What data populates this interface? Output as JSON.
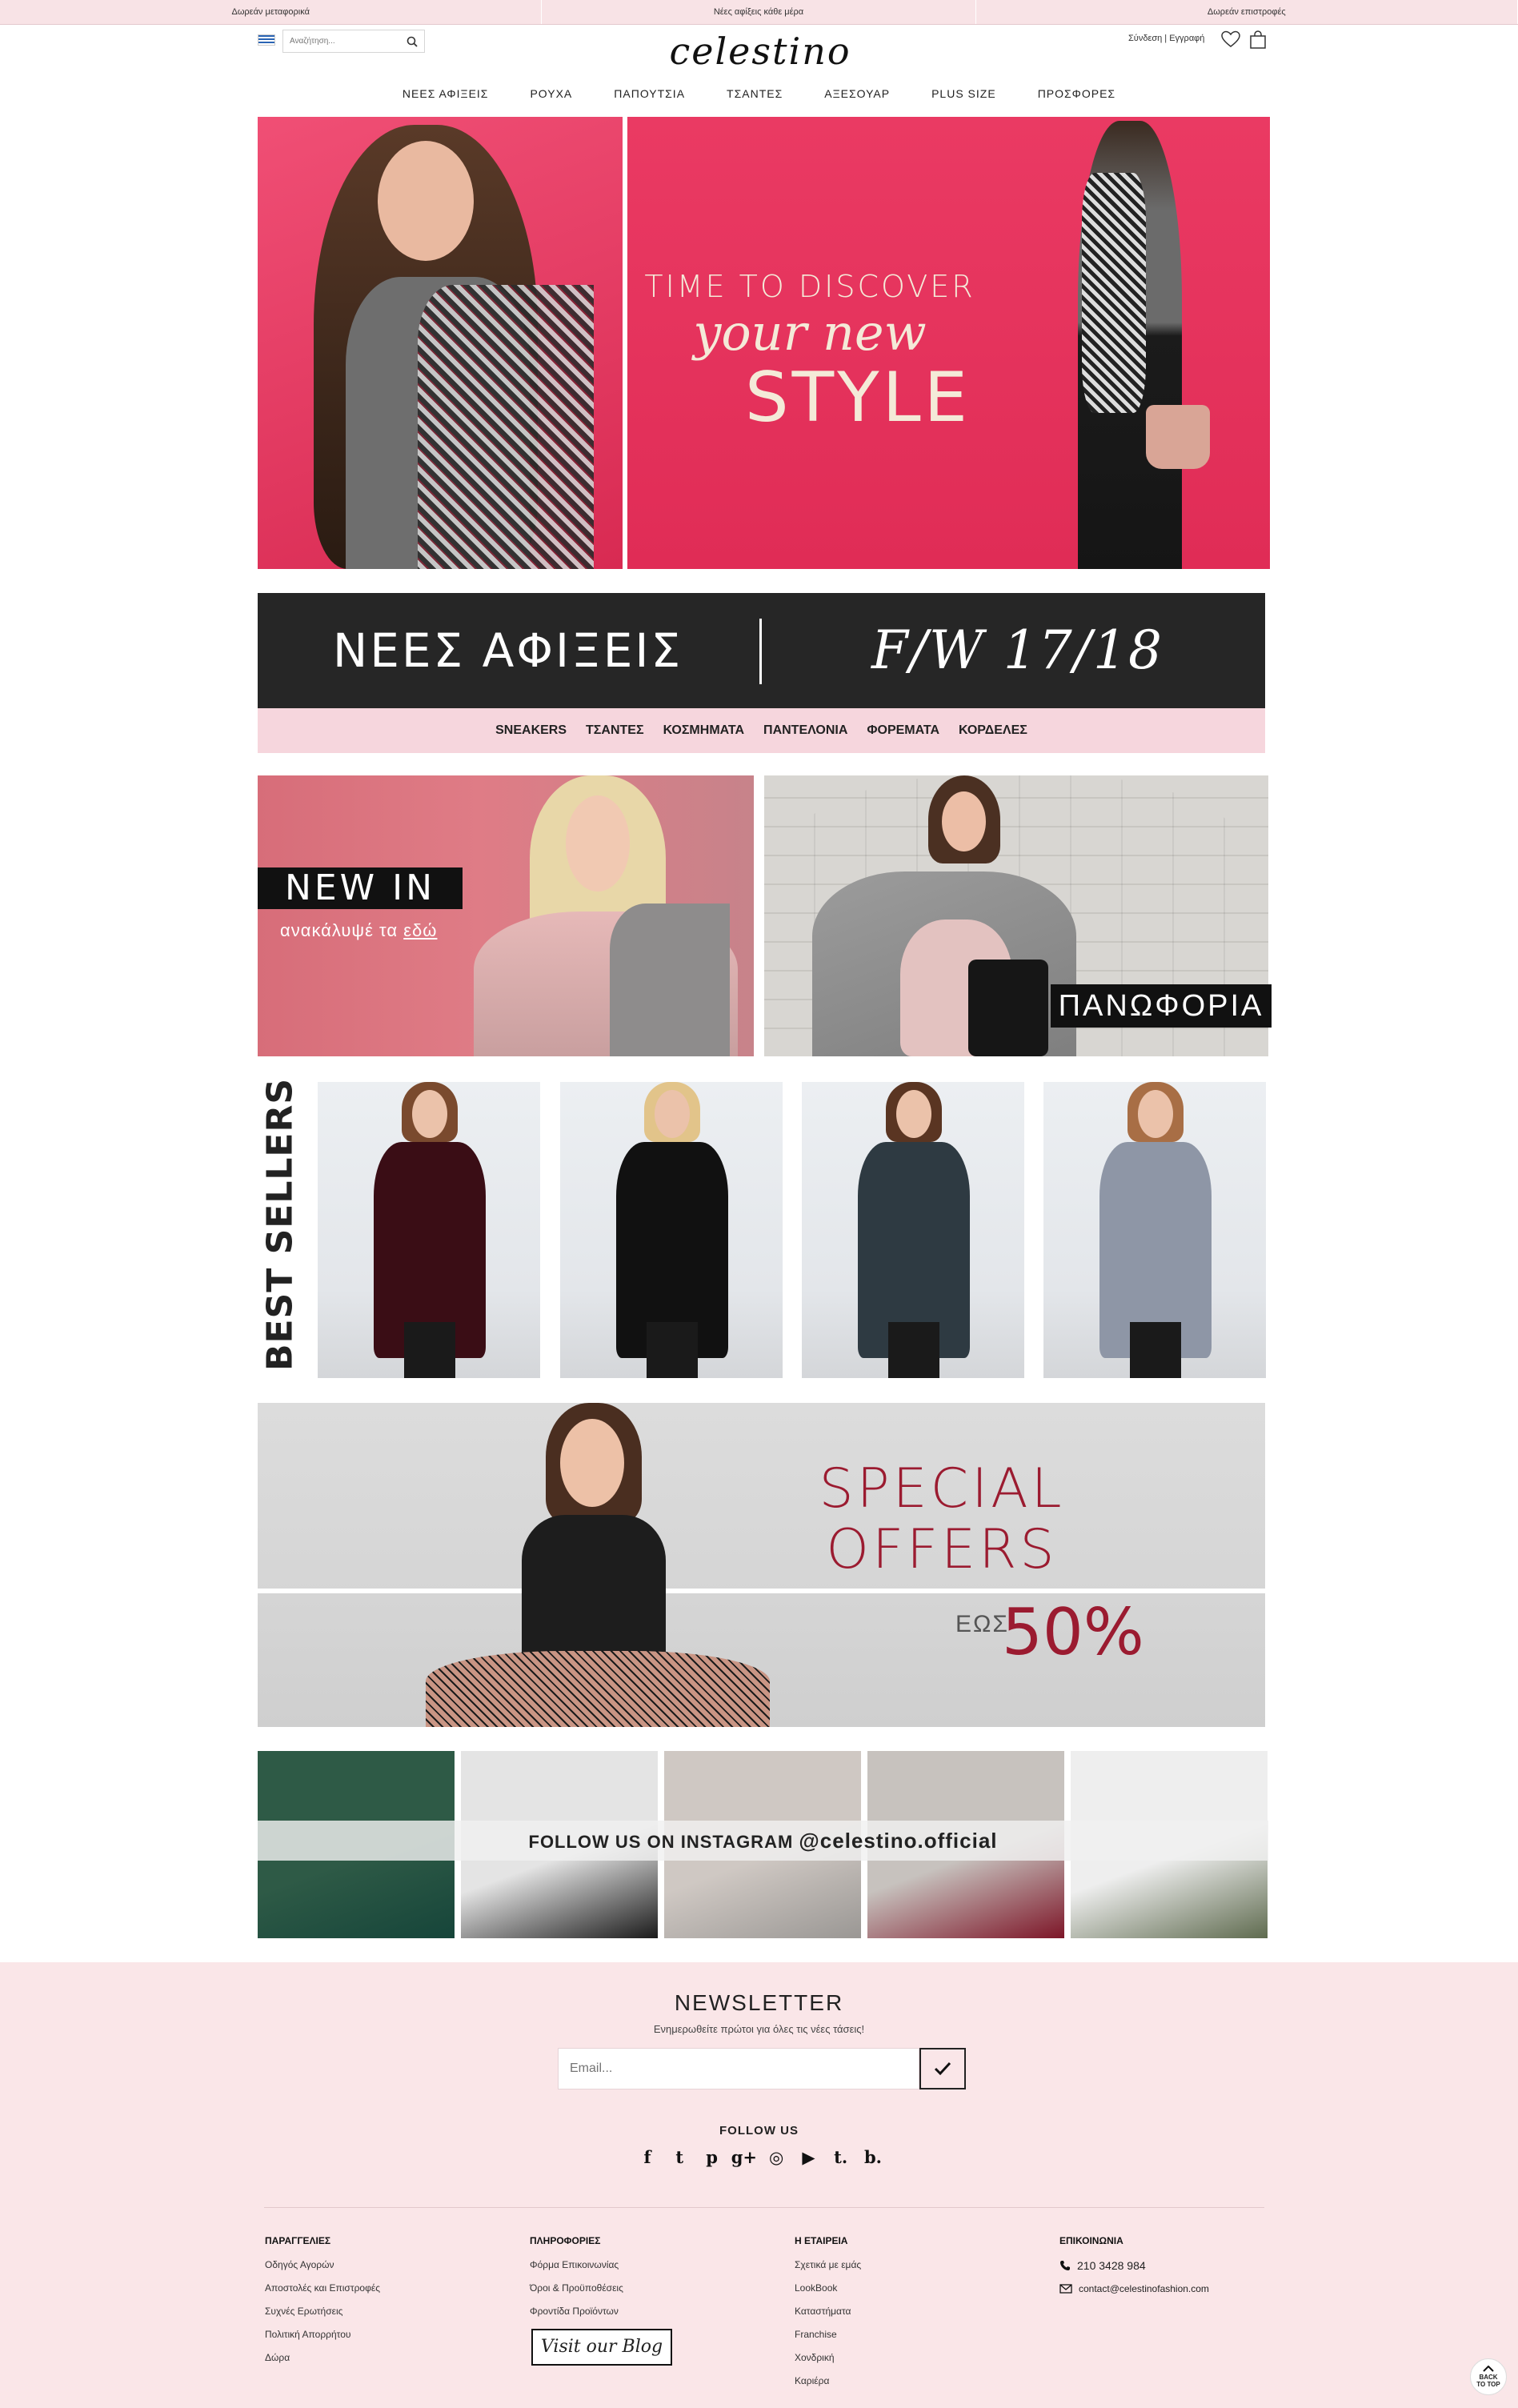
{
  "topbar": {
    "items": [
      "Δωρεάν μεταφορικά",
      "Νέες αφίξεις κάθε μέρα",
      "Δωρεάν επιστροφές"
    ]
  },
  "header": {
    "logo": "celestino",
    "search_placeholder": "Αναζήτηση...",
    "account_link": "Σύνδεση | Εγγραφή",
    "nav": [
      "ΝΕΕΣ ΑΦΙΞΕΙΣ",
      "ΡΟΥΧΑ",
      "ΠΑΠΟΥΤΣΙΑ",
      "ΤΣΑΝΤΕΣ",
      "ΑΞΕΣΟΥΑΡ",
      "PLUS SIZE",
      "ΠΡΟΣΦΟΡΕΣ"
    ]
  },
  "hero": {
    "line1": "TIME TO DISCOVER",
    "line2": "your new",
    "line3": "STYLE"
  },
  "arrivals": {
    "left": "ΝΕΕΣ ΑΦΙΞΕΙΣ",
    "right": "F/W 17/18",
    "categories": [
      "SNEAKERS",
      "ΤΣΑΝΤΕΣ",
      "ΚΟΣΜΗΜΑΤΑ",
      "ΠΑΝΤΕΛΟΝΙΑ",
      "ΦΟΡΕΜΑΤΑ",
      "ΚΟΡΔΕΛΕΣ"
    ]
  },
  "promos": {
    "newin_title": "NEW IN",
    "newin_sub": "ανακάλυψέ τα",
    "newin_link": "εδώ",
    "outerwear": "ΠΑΝΩΦΟΡΙΑ"
  },
  "bestsellers": {
    "label": "BEST SELLERS",
    "products": [
      {
        "name": "kimono-velvet",
        "hair": "#7a4a2e",
        "body": "#3a0d15"
      },
      {
        "name": "maxi-jumpsuit",
        "hair": "#e2c48a",
        "body": "#111111"
      },
      {
        "name": "bell-sleeve-dress",
        "hair": "#5a3522",
        "body": "#2e3a42"
      },
      {
        "name": "satin-cami",
        "hair": "#a86e45",
        "body": "#8e96a6"
      }
    ]
  },
  "offers": {
    "line1": "SPECIAL",
    "line2": "OFFERS",
    "upto": "ΕΩΣ",
    "percent": "50%"
  },
  "instagram": {
    "text": "FOLLOW US ON INSTAGRAM",
    "handle": "@celestino.official",
    "tiles": [
      {
        "bg": "#2e5a46",
        "accent": "#16453a"
      },
      {
        "bg": "#e4e4e4",
        "accent": "#1b1b1b"
      },
      {
        "bg": "#cfc8c3",
        "accent": "#9a9794"
      },
      {
        "bg": "#c7c2be",
        "accent": "#7d1628"
      },
      {
        "bg": "#eeeeee",
        "accent": "#5f6b4f"
      }
    ]
  },
  "newsletter": {
    "title": "NEWSLETTER",
    "subtitle": "Ενημερωθείτε πρώτοι για όλες τις νέες τάσεις!",
    "placeholder": "Email..."
  },
  "follow": {
    "title": "FOLLOW US",
    "icons": [
      "facebook-icon",
      "twitter-icon",
      "pinterest-icon",
      "google-plus-icon",
      "instagram-icon",
      "youtube-icon",
      "tumblr-icon",
      "blog-icon"
    ],
    "glyphs": [
      "f",
      "t",
      "p",
      "g+",
      "◎",
      "▶",
      "t.",
      "b."
    ]
  },
  "footer": {
    "col1": {
      "title": "ΠΑΡΑΓΓΕΛΙΕΣ",
      "links": [
        "Οδηγός Αγορών",
        "Αποστολές και Επιστροφές",
        "Συχνές Ερωτήσεις",
        "Πολιτική Απορρήτου",
        "Δώρα"
      ]
    },
    "col2": {
      "title": "ΠΛΗΡΟΦΟΡΙΕΣ",
      "links": [
        "Φόρμα Επικοινωνίας",
        "Όροι & Προϋποθέσεις",
        "Φροντίδα Προϊόντων"
      ],
      "blog": "Visit our Blog"
    },
    "col3": {
      "title": "Η ΕΤΑΙΡΕΙΑ",
      "links": [
        "Σχετικά με εμάς",
        "LookBook",
        "Καταστήματα",
        "Franchise",
        "Χονδρική",
        "Καριέρα"
      ]
    },
    "col4": {
      "title": "ΕΠΙΚΟΙΝΩΝΙΑ",
      "phone": "210 3428 984",
      "email": "contact@celestinofashion.com"
    }
  },
  "backtop": {
    "line1": "BACK",
    "line2": "TO TOP"
  }
}
